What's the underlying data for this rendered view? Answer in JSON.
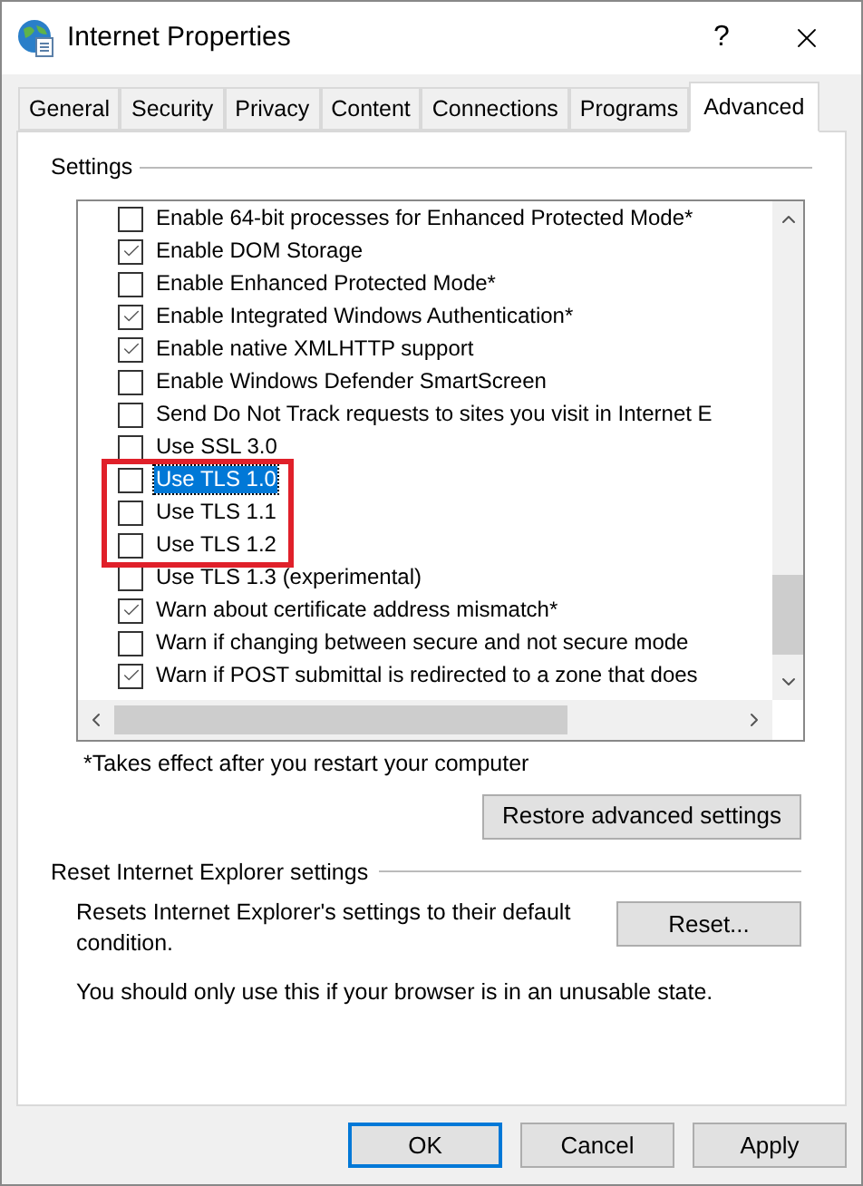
{
  "window": {
    "title": "Internet Properties",
    "help": "?"
  },
  "tabs": [
    {
      "label": "General",
      "selected": false
    },
    {
      "label": "Security",
      "selected": false
    },
    {
      "label": "Privacy",
      "selected": false
    },
    {
      "label": "Content",
      "selected": false
    },
    {
      "label": "Connections",
      "selected": false
    },
    {
      "label": "Programs",
      "selected": false
    },
    {
      "label": "Advanced",
      "selected": true
    }
  ],
  "settings": {
    "title": "Settings",
    "items": [
      {
        "label": "Enable 64-bit processes for Enhanced Protected Mode*",
        "checked": false,
        "selected": false,
        "highlighted": false
      },
      {
        "label": "Enable DOM Storage",
        "checked": true,
        "selected": false,
        "highlighted": false
      },
      {
        "label": "Enable Enhanced Protected Mode*",
        "checked": false,
        "selected": false,
        "highlighted": false
      },
      {
        "label": "Enable Integrated Windows Authentication*",
        "checked": true,
        "selected": false,
        "highlighted": false
      },
      {
        "label": "Enable native XMLHTTP support",
        "checked": true,
        "selected": false,
        "highlighted": false
      },
      {
        "label": "Enable Windows Defender SmartScreen",
        "checked": false,
        "selected": false,
        "highlighted": false
      },
      {
        "label": "Send Do Not Track requests to sites you visit in Internet E",
        "checked": false,
        "selected": false,
        "highlighted": false
      },
      {
        "label": "Use SSL 3.0",
        "checked": false,
        "selected": false,
        "highlighted": false
      },
      {
        "label": "Use TLS 1.0",
        "checked": false,
        "selected": true,
        "highlighted": true
      },
      {
        "label": "Use TLS 1.1",
        "checked": false,
        "selected": false,
        "highlighted": true
      },
      {
        "label": "Use TLS 1.2",
        "checked": false,
        "selected": false,
        "highlighted": true
      },
      {
        "label": "Use TLS 1.3 (experimental)",
        "checked": false,
        "selected": false,
        "highlighted": false
      },
      {
        "label": "Warn about certificate address mismatch*",
        "checked": true,
        "selected": false,
        "highlighted": false
      },
      {
        "label": "Warn if changing between secure and not secure mode",
        "checked": false,
        "selected": false,
        "highlighted": false
      },
      {
        "label": "Warn if POST submittal is redirected to a zone that does",
        "checked": true,
        "selected": false,
        "highlighted": false
      }
    ],
    "note": "*Takes effect after you restart your computer",
    "restore_button": "Restore advanced settings"
  },
  "reset": {
    "title": "Reset Internet Explorer settings",
    "description": "Resets Internet Explorer's settings to their default condition.",
    "button": "Reset...",
    "warning": "You should only use this if your browser is in an unusable state."
  },
  "buttons": [
    {
      "label": "OK",
      "default": true
    },
    {
      "label": "Cancel",
      "default": false
    },
    {
      "label": "Apply",
      "default": false
    }
  ]
}
